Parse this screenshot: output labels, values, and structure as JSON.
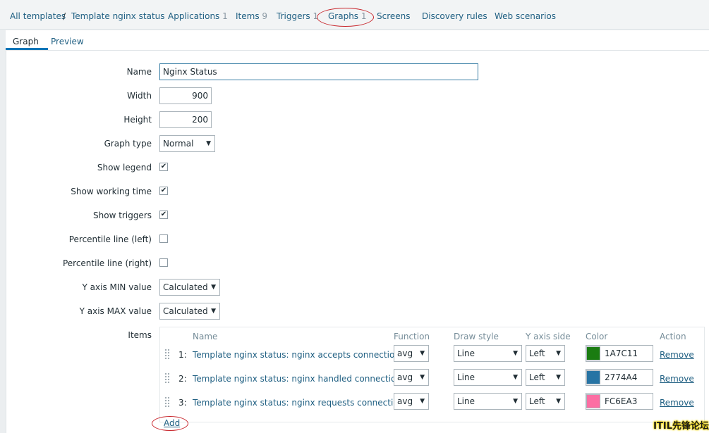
{
  "breadcrumb": {
    "all_templates": "All templates",
    "separator": "/",
    "template": "Template nginx status",
    "applications": {
      "label": "Applications",
      "count": "1"
    },
    "items": {
      "label": "Items",
      "count": "9"
    },
    "triggers": {
      "label": "Triggers",
      "count": "1"
    },
    "graphs": {
      "label": "Graphs",
      "count": "1"
    },
    "screens": "Screens",
    "discovery_rules": "Discovery rules",
    "web_scenarios": "Web scenarios"
  },
  "tabs": {
    "graph": "Graph",
    "preview": "Preview"
  },
  "form": {
    "name": {
      "label": "Name",
      "value": "Nginx Status"
    },
    "width": {
      "label": "Width",
      "value": "900"
    },
    "height": {
      "label": "Height",
      "value": "200"
    },
    "graph_type": {
      "label": "Graph type",
      "value": "Normal"
    },
    "show_legend": {
      "label": "Show legend",
      "checked": true
    },
    "show_working_time": {
      "label": "Show working time",
      "checked": true
    },
    "show_triggers": {
      "label": "Show triggers",
      "checked": true
    },
    "percentile_left": {
      "label": "Percentile line (left)",
      "checked": false
    },
    "percentile_right": {
      "label": "Percentile line (right)",
      "checked": false
    },
    "y_min": {
      "label": "Y axis MIN value",
      "value": "Calculated"
    },
    "y_max": {
      "label": "Y axis MAX value",
      "value": "Calculated"
    },
    "items_label": "Items"
  },
  "items_table": {
    "headers": {
      "name": "Name",
      "function": "Function",
      "draw_style": "Draw style",
      "y_axis_side": "Y axis side",
      "color": "Color",
      "action": "Action"
    },
    "rows": [
      {
        "num": "1:",
        "name": "Template nginx status: nginx accepts connections",
        "function": "avg",
        "draw_style": "Line",
        "y_axis_side": "Left",
        "color": "1A7C11",
        "action": "Remove"
      },
      {
        "num": "2:",
        "name": "Template nginx status: nginx handled connections",
        "function": "avg",
        "draw_style": "Line",
        "y_axis_side": "Left",
        "color": "2774A4",
        "action": "Remove"
      },
      {
        "num": "3:",
        "name": "Template nginx status: nginx requests connections",
        "function": "avg",
        "draw_style": "Line",
        "y_axis_side": "Left",
        "color": "FC6EA3",
        "action": "Remove"
      }
    ],
    "add_label": "Add"
  },
  "colors": {
    "link": "#1f5f82",
    "active_tab": "#0275b8",
    "annotation": "#c8262c"
  },
  "icons": {
    "checkmark": "check-icon",
    "dropdown": "chevron-down-icon",
    "drag": "drag-handle-icon"
  },
  "watermark": "ITIL先锋论坛"
}
